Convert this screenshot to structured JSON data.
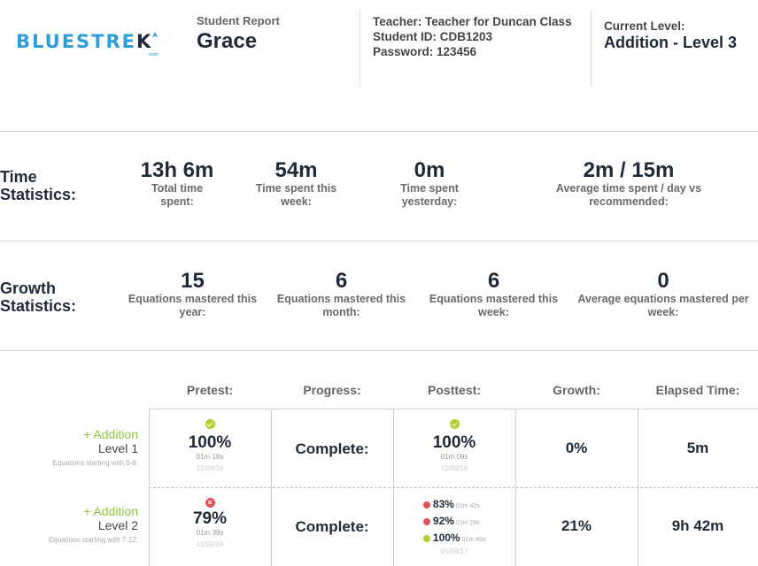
{
  "header": {
    "logo": {
      "text_blue": "BLUESTRE",
      "text_dark": "",
      "text_tail": "K",
      "sub": "math"
    },
    "report_label": "Student Report",
    "student_name": "Grace",
    "teacher_line": "Teacher: Teacher for Duncan Class",
    "student_id_line": "Student ID: CDB1203",
    "password_line": "Password: 123456",
    "current_level_label": "Current Level:",
    "current_level_value": "Addition - Level 3"
  },
  "time_stats": {
    "title": "Time Statistics:",
    "items": [
      {
        "value": "13h 6m",
        "caption": "Total time spent:"
      },
      {
        "value": "54m",
        "caption": "Time spent this week:"
      },
      {
        "value": "0m",
        "caption": "Time spent yesterday:"
      },
      {
        "value": "2m / 15m",
        "caption": "Average time spent / day vs recommended:"
      }
    ]
  },
  "growth_stats": {
    "title": "Growth Statistics:",
    "items": [
      {
        "value": "15",
        "caption": "Equations mastered this year:"
      },
      {
        "value": "6",
        "caption": "Equations mastered this month:"
      },
      {
        "value": "6",
        "caption": "Equations mastered this week:"
      },
      {
        "value": "0",
        "caption": "Average equations mastered per week:"
      }
    ]
  },
  "table": {
    "headers": [
      "Pretest:",
      "Progress:",
      "Posttest:",
      "Growth:",
      "Elapsed Time:"
    ],
    "rows": [
      {
        "category": "Addition",
        "level": "Level 1",
        "sub": "Equations starting with 0-6:",
        "pretest": {
          "status": "pass",
          "pct": "100%",
          "time": "01m 18s",
          "date": "11/09/16"
        },
        "progress": "Complete:",
        "posttest": {
          "status": "pass",
          "pct": "100%",
          "time": "01m 09s",
          "date": "11/09/16"
        },
        "growth": "0%",
        "elapsed": "5m"
      },
      {
        "category": "Addition",
        "level": "Level 2",
        "sub": "Equations starting with 7-12:",
        "pretest": {
          "status": "fail",
          "pct": "79%",
          "time": "01m 39s",
          "date": "11/09/16"
        },
        "progress": "Complete:",
        "posttest_attempts": [
          {
            "status": "fail",
            "pct": "83%",
            "time": "01m 42s"
          },
          {
            "status": "fail",
            "pct": "92%",
            "time": "01m 28s"
          },
          {
            "status": "pass",
            "pct": "100%",
            "time": "01m 46s"
          }
        ],
        "posttest_date": "05/08/17",
        "growth": "21%",
        "elapsed": "9h 42m"
      }
    ]
  },
  "colors": {
    "brand_blue": "#2d9ed8",
    "dark": "#1f2a38",
    "green": "#8cc63f",
    "pass": "#b5cc2c",
    "fail": "#e2505b"
  }
}
